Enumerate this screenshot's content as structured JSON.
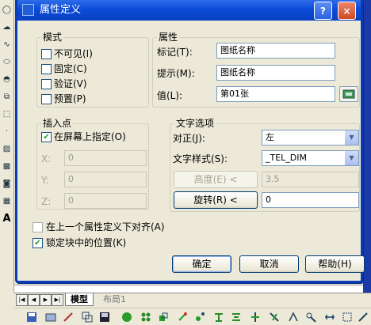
{
  "dialog": {
    "title": "属性定义",
    "help_glyph": "?",
    "close_glyph": "×"
  },
  "mode": {
    "legend": "模式",
    "options": [
      {
        "label": "不可见(I)",
        "checked": false
      },
      {
        "label": "固定(C)",
        "checked": false
      },
      {
        "label": "验证(V)",
        "checked": false
      },
      {
        "label": "预置(P)",
        "checked": false
      }
    ]
  },
  "attribute": {
    "legend": "属性",
    "tag_label": "标记(T):",
    "tag_value": "图纸名称",
    "prompt_label": "提示(M):",
    "prompt_value": "图纸名称",
    "value_label": "值(L):",
    "value_value": "第01张"
  },
  "insertion": {
    "legend": "插入点",
    "on_screen_label": "在屏幕上指定(O)",
    "on_screen_checked": true,
    "x_label": "X:",
    "x_value": "0",
    "y_label": "Y:",
    "y_value": "0",
    "z_label": "Z:",
    "z_value": "0"
  },
  "text_options": {
    "legend": "文字选项",
    "justify_label": "对正(J):",
    "justify_value": "左",
    "style_label": "文字样式(S):",
    "style_value": "_TEL_DIM",
    "height_button": "高度(E) <",
    "height_value": "3.5",
    "rotation_button": "旋转(R) <",
    "rotation_value": "0"
  },
  "align_below_label": "在上一个属性定义下对齐(A)",
  "align_below_checked": false,
  "lock_position_label": "锁定块中的位置(K)",
  "lock_position_checked": true,
  "buttons": {
    "ok": "确定",
    "cancel": "取消",
    "help": "帮助(H)"
  },
  "layout_tabs": {
    "model": "模型",
    "layout1": "布局1"
  },
  "left_palette_letter": "A",
  "colors": {
    "titlebar": "#0b4bd8",
    "dialog_bg": "#ece9d8",
    "check": "#21a121"
  }
}
